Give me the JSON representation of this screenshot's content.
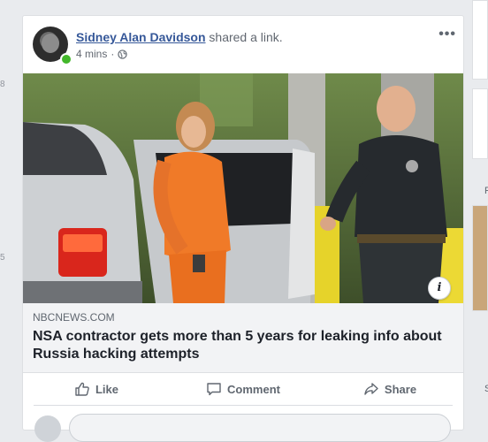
{
  "gutter": {
    "numbers": [
      "8",
      "5"
    ]
  },
  "post": {
    "author": "Sidney Alan Davidson",
    "action": "shared a link.",
    "time": "4 mins",
    "separator": "·",
    "more": "•••"
  },
  "link": {
    "info": "i",
    "domain": "NBCNEWS.COM",
    "headline": "NSA contractor gets more than 5 years for leaking info about Russia hacking attempts"
  },
  "actions": {
    "like": "Like",
    "comment": "Comment",
    "share": "Share"
  },
  "right_rail": {
    "letters": [
      "F",
      "S"
    ]
  },
  "colors": {
    "link_blue": "#365899",
    "online_green": "#42b72a",
    "page_bg": "#e9ebee"
  }
}
